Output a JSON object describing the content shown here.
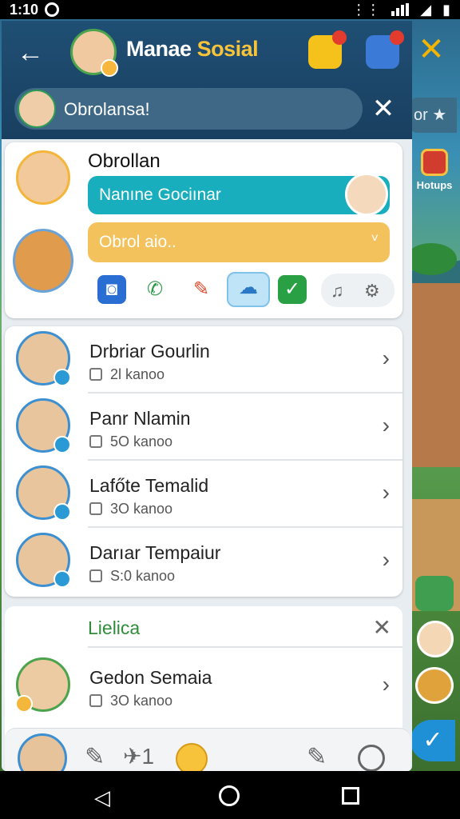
{
  "status_bar": {
    "time": "1:10"
  },
  "header": {
    "title_part1": "Manae",
    "title_part2": "Sosial",
    "colors": {
      "header_bg": "#1f4f74",
      "accent": "#f6c33b"
    }
  },
  "search": {
    "value": "Obrolansa!"
  },
  "side": {
    "star_label": "or ★",
    "tasks_label": "Hotups"
  },
  "chat_card": {
    "name": "Obrollan",
    "teal_pill_text": "Nanıne Gociınar",
    "yellow_pill_text": "Obrol aio..",
    "yellow_pill_chevron": "˅"
  },
  "friends": [
    {
      "name": "Drbriar Gourlin",
      "meta": "2Ɩ kanoo"
    },
    {
      "name": "Panr Nlamin",
      "meta": "5O kanoo"
    },
    {
      "name": "Lafőte Temalid",
      "meta": "3O kanoo"
    },
    {
      "name": "Darıar Tempaiur",
      "meta": "S:0 kanoo"
    }
  ],
  "lists_section": {
    "title": "Lielica",
    "items": [
      {
        "name": "Gedon Semaia",
        "meta": "3O kanoo"
      }
    ]
  },
  "bottom_bar": {
    "pin_count": "1"
  }
}
